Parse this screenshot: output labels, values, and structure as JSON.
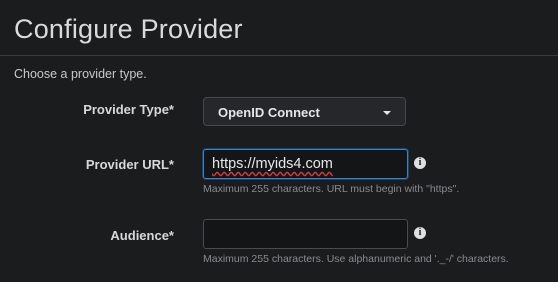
{
  "header": {
    "title": "Configure Provider",
    "subtitle": "Choose a provider type."
  },
  "form": {
    "provider_type": {
      "label": "Provider Type*",
      "value": "OpenID Connect"
    },
    "provider_url": {
      "label": "Provider URL*",
      "value": "https://myids4.com",
      "hint": "Maximum 255 characters. URL must begin with \"https\".",
      "info_icon": "info-icon"
    },
    "audience": {
      "label": "Audience*",
      "value": "",
      "hint": "Maximum 255 characters. Use alphanumeric and '._-/' characters.",
      "info_icon": "info-icon"
    }
  },
  "colors": {
    "background": "#1b1c1e",
    "focus_border": "#2f86d6",
    "hint_text": "#8a8b8f"
  }
}
